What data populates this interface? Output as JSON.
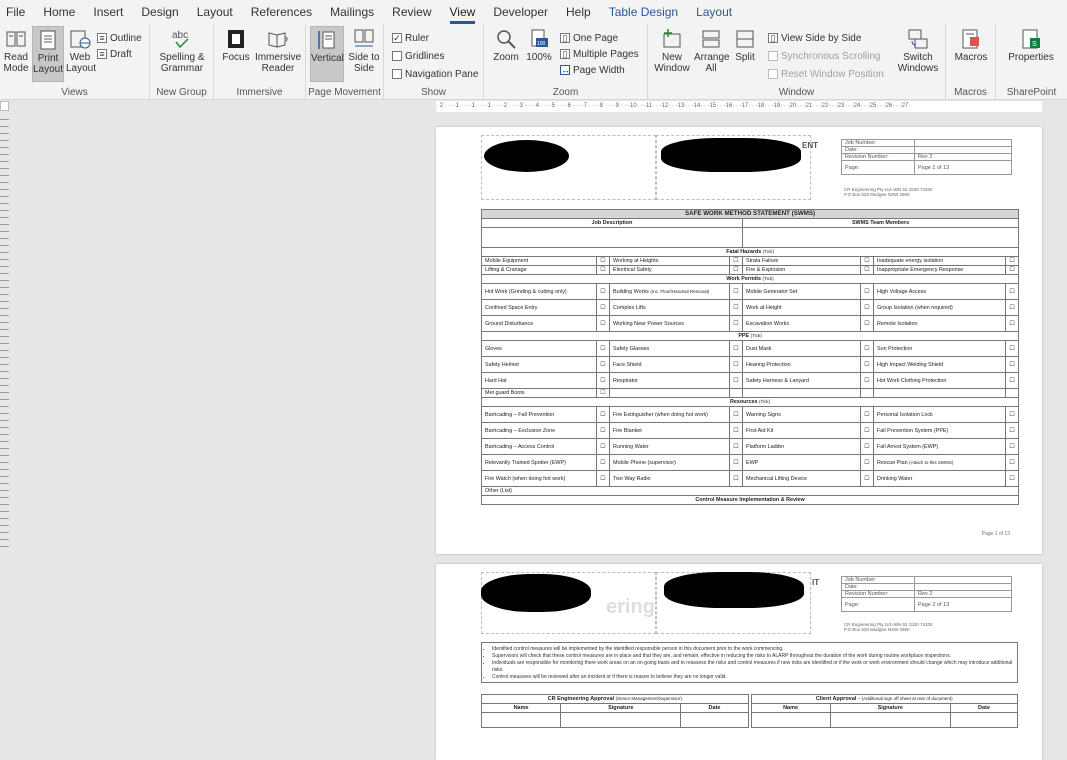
{
  "menu": {
    "tabs": [
      "File",
      "Home",
      "Insert",
      "Design",
      "Layout",
      "References",
      "Mailings",
      "Review",
      "View",
      "Developer",
      "Help",
      "Table Design",
      "Layout"
    ],
    "active": "View"
  },
  "ribbon": {
    "views": {
      "read_mode": "Read Mode",
      "print_layout": "Print Layout",
      "web_layout": "Web Layout",
      "outline": "Outline",
      "draft": "Draft",
      "label": "Views"
    },
    "new_group": {
      "spelling": "Spelling & Grammar",
      "label": "New Group"
    },
    "immersive": {
      "focus": "Focus",
      "reader": "Immersive Reader",
      "label": "Immersive"
    },
    "page_movement": {
      "vertical": "Vertical",
      "side": "Side to Side",
      "label": "Page Movement"
    },
    "show": {
      "ruler": "Ruler",
      "gridlines": "Gridlines",
      "nav": "Navigation Pane",
      "label": "Show"
    },
    "zoom": {
      "zoom": "Zoom",
      "hundred": "100%",
      "one_page": "One Page",
      "multiple": "Multiple Pages",
      "width": "Page Width",
      "label": "Zoom"
    },
    "window": {
      "new": "New Window",
      "arrange": "Arrange All",
      "split": "Split",
      "side_by_side": "View Side by Side",
      "sync": "Synchronous Scrolling",
      "reset": "Reset Window Position",
      "switch": "Switch Windows",
      "label": "Window"
    },
    "macros": {
      "macros": "Macros",
      "label": "Macros"
    },
    "sharepoint": {
      "properties": "Properties",
      "label": "SharePoint"
    }
  },
  "ruler": {
    "text": "· 2 · · · 1 · · · 1 · · · 1 · · · 2 · · · 3 · · · 4 · · · 5 · · · 6 · · · 7 · · · 8 · · · 9 · · ·10· · ·11· · ·12· · ·13· · ·14· · ·15· · ·16· · ·17· · ·18· · ·19· · ·20· · ·21· · ·22· · ·23· · ·24· · ·25· · ·26· · ·27·"
  },
  "doc_header": {
    "partial_word": "ENT",
    "partial_word2": "IT",
    "faded_word": "ering",
    "fields": [
      "Job Number:",
      "Date:",
      "Revision Number:",
      "Page:"
    ],
    "revision": "Rev 2",
    "page1": "Page 1 of 13",
    "page2": "Page 2 of 13",
    "company_line1": "CR Engineering Pty Ltd  ABN 52 1530 74330",
    "company_line2": "P.O Box 529 Mudgee NSW 2850"
  },
  "swms": {
    "title": "SAFE WORK METHOD STATEMENT (SWMS)",
    "job_description": "Job Description",
    "team_members": "SWMS Team Members",
    "fatal_hazards": "Fatal Hazards",
    "work_permits": "Work Permits",
    "ppe": "PPE",
    "resources": "Resources",
    "tick": "(Tick)",
    "fatal_rows": [
      [
        "Mobile Equipment",
        "Working at Heights",
        "Strata Failure",
        "Inadequate energy isolation"
      ],
      [
        "Lifting & Cranage",
        "Electrical Safety",
        "Fire & Explosion",
        "Inappropriate Emergency Response"
      ]
    ],
    "permit_rows": [
      [
        "Hot Work (Grinding & cutting only)",
        "Building Works",
        "Mobile Generator Set",
        "High Voltage Access"
      ],
      [
        "Confined Space Entry",
        "Complex Lifts",
        "Work at Height",
        "Group Isolation (when required)"
      ],
      [
        "Ground Disturbance",
        "Working Near Power Sources",
        "Excavation Works",
        "Remote Isolation"
      ]
    ],
    "building_note": "(Inc. Floor/Handrail Removal)",
    "ppe_rows": [
      [
        "Gloves",
        "Safety Glasses",
        "Dust Mask",
        "Sun Protection"
      ],
      [
        "Safety Helmet",
        "Face Shield",
        "Hearing Protection",
        "High Impact Welding Shield"
      ],
      [
        "Hard Hat",
        "Respirator",
        "Safety Harness & Lanyard",
        "Hot Work Clothing Protection"
      ]
    ],
    "ppe_last": "Met guard Boots",
    "resource_rows": [
      [
        "Barricading – Fall Prevention",
        "Fire Extinguisher (when doing hot work)",
        "Warning Signs",
        "Personal Isolation Lock"
      ],
      [
        "Barricading – Exclusion Zone",
        "Fire Blanket",
        "First Aid Kit",
        "Fall Prevention System (PPE)"
      ],
      [
        "Barricading – Access Control",
        "Running Water",
        "Platform Ladder",
        "Fall Arrest System (EWP)"
      ],
      [
        "Relevantly Trained Spotter (EWP)",
        "Mobile Phone (supervisor)",
        "EWP",
        "Rescue Plan"
      ],
      [
        "Fire Watch (when doing hot work)",
        "Two Way Radio",
        "Mechanical Lifting Device",
        "Drinking Water"
      ]
    ],
    "rescue_note": "(Attach to this SWMS)",
    "other": "Other (List)",
    "control": "Control Measure Implementation & Review",
    "checkbox": "☐"
  },
  "page1_footer": "Page 1 of 13",
  "page2": {
    "bullets": [
      "Identified control measures will be implemented by the identified responsible person in this document prior to the work commencing.",
      "Supervisors will check that these control measures are in place and that they are, and remain, effective in reducing the risks to ALARP throughout the duration of the work during routine workplace inspections.",
      "Individuals are responsible for monitoring there work areas on an on-going basis and to reassess the risks and control measures if new risks are identified or if the work or work environment should change which may introduce additional risks.",
      "Control measures will be reviewed after an incident or if there is reason to believe they are no longer valid."
    ],
    "cr_approval": "CR Engineering Approval",
    "cr_note": "(Senior Management/Supervisor)",
    "client_approval": "Client Approval",
    "client_note": "– (Additional sign off sheet at rear of document)",
    "cols": [
      "Name",
      "Signature",
      "Date"
    ]
  }
}
